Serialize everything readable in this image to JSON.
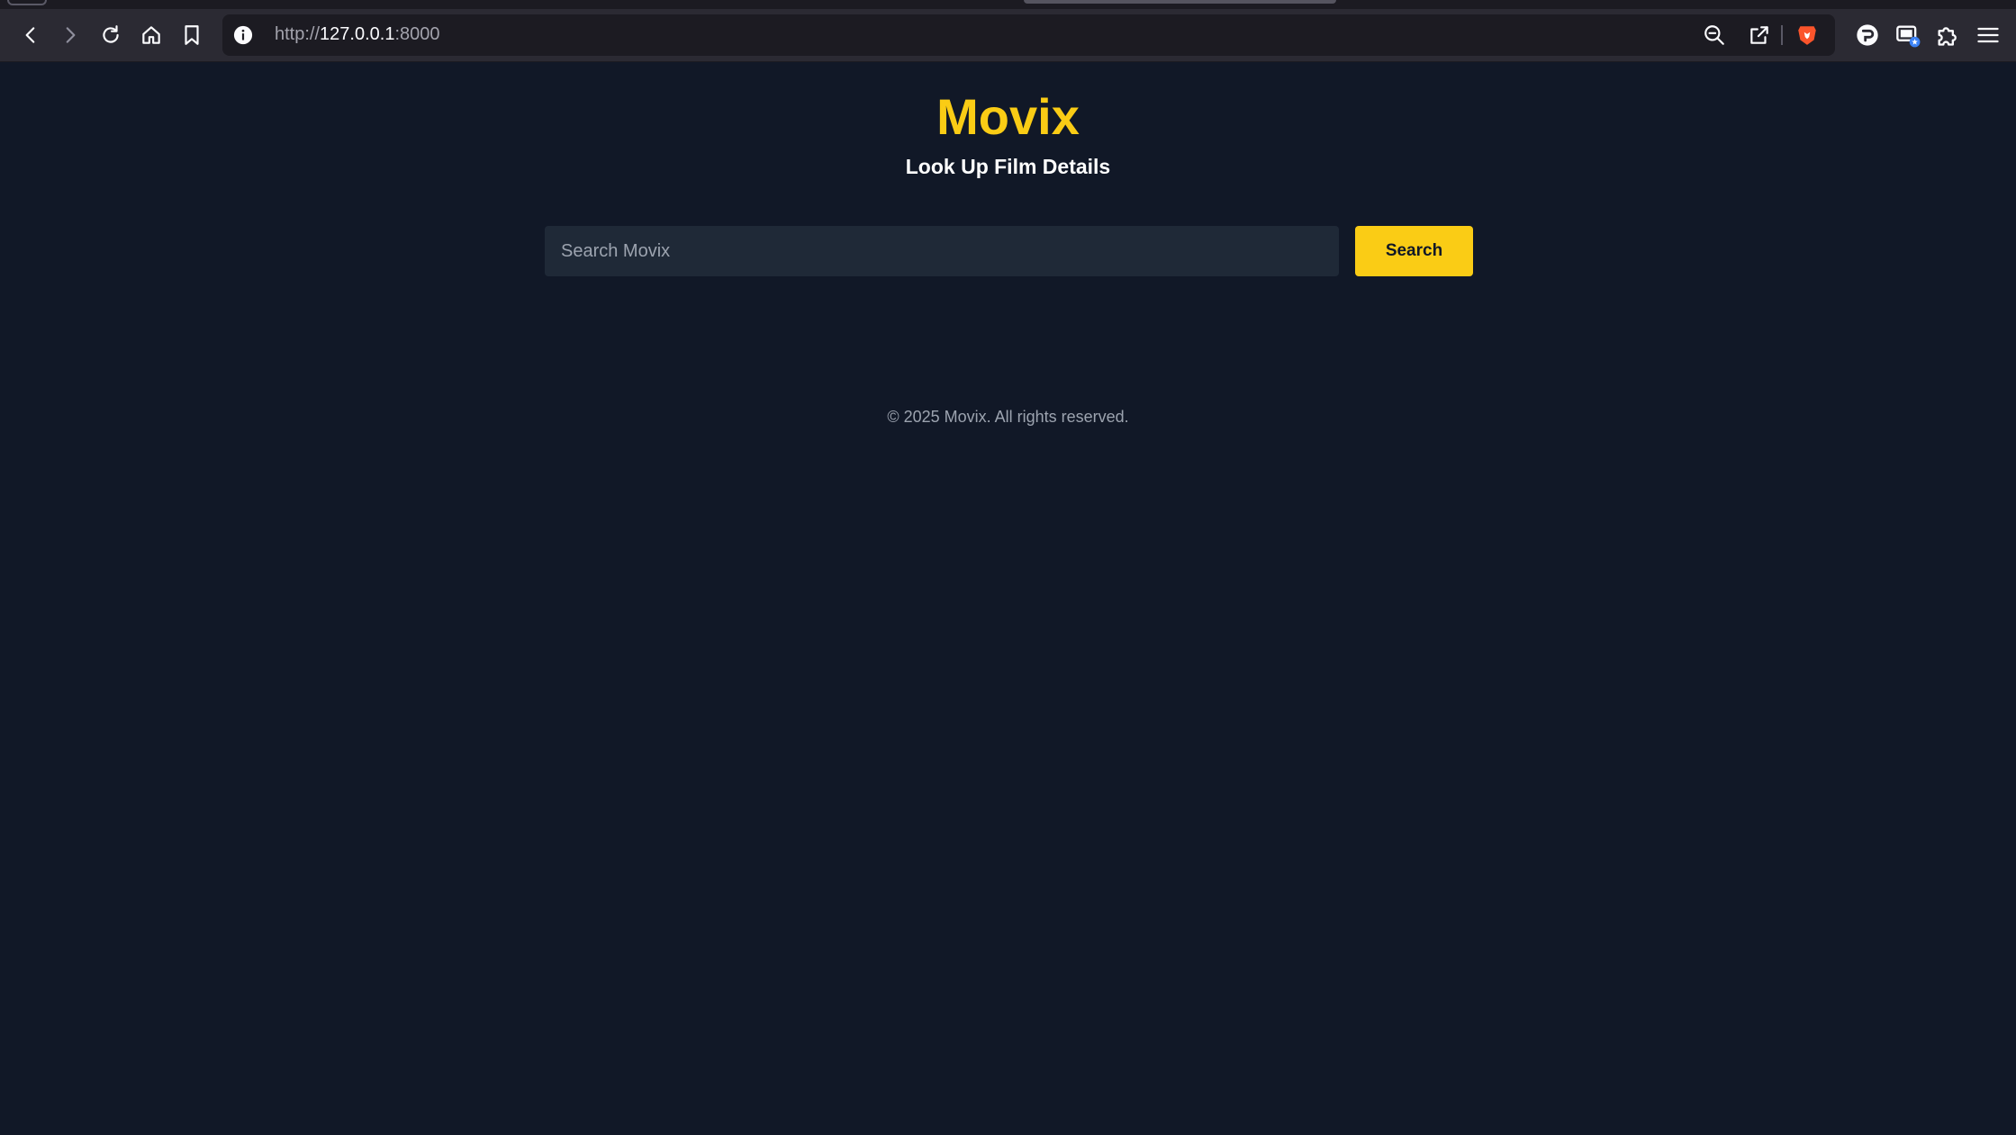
{
  "browser": {
    "url_scheme": "http://",
    "url_host": "127.0.0.1",
    "url_port": ":8000",
    "icons": {
      "back": "back-arrow-icon",
      "forward": "forward-arrow-icon",
      "reload": "reload-icon",
      "home": "home-icon",
      "bookmark": "bookmark-icon",
      "site_info": "info-icon",
      "zoom": "zoom-out-icon",
      "share": "share-icon",
      "brave_shields": "brave-lion-icon",
      "extension_a": "extension-icon",
      "extension_b": "window-badge-icon",
      "extensions": "puzzle-icon",
      "menu": "hamburger-menu-icon"
    },
    "colors": {
      "chrome_bg": "#2b2a33",
      "urlbar_bg": "#1c1b22",
      "brave_orange": "#fb542b",
      "badge_blue": "#3b82f6"
    }
  },
  "page": {
    "brand": "Movix",
    "tagline": "Look Up Film Details",
    "search": {
      "placeholder": "Search Movix",
      "value": "",
      "button_label": "Search"
    },
    "footer": "© 2025 Movix. All rights reserved.",
    "colors": {
      "background": "#111827",
      "accent": "#facc15",
      "input_bg": "#1f2937",
      "muted_text": "#9ca3af"
    }
  }
}
